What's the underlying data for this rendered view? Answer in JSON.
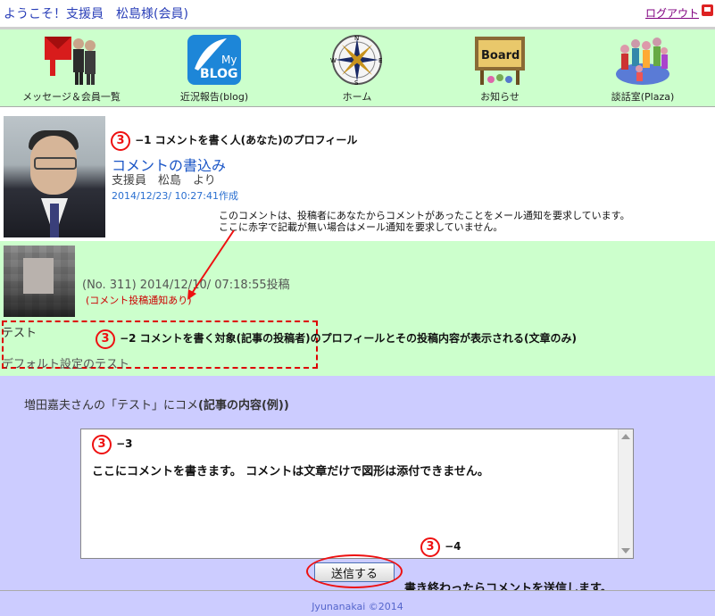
{
  "header": {
    "welcome": "ようこそ！支援員　松島様(会員)",
    "logout": "ログアウト"
  },
  "nav": [
    {
      "label": "メッセージ＆会員一覧",
      "icon": "message-members-icon"
    },
    {
      "label": "近況報告(blog)",
      "icon": "my-blog-icon",
      "badge_top": "My",
      "badge_bottom": "BLOG"
    },
    {
      "label": "ホーム",
      "icon": "compass-icon",
      "compass": [
        "N",
        "E",
        "S",
        "W"
      ]
    },
    {
      "label": "お知らせ",
      "icon": "board-icon",
      "board_text": "Board"
    },
    {
      "label": "談話室(Plaza)",
      "icon": "plaza-icon"
    }
  ],
  "profile": {
    "annotation_num": "3",
    "annotation_text": "−1 コメントを書く人(あなた)のプロフィール",
    "title": "コメントの書込み",
    "author": "支援員　松島　より",
    "created": "2014/12/23/ 10:27:41作成",
    "explain_1": "このコメントは、投稿者にあなたからコメントがあったことをメール通知を要求しています。",
    "explain_2": "ここに赤字で記載が無い場合はメール通知を要求していません。"
  },
  "article": {
    "post_info": "(No. 311) 2014/12/10/ 07:18:55投稿",
    "notify": "(コメント投稿通知あり)",
    "title": "テスト",
    "body": "デフォルト設定のテスト",
    "annotation_num": "3",
    "annotation_text": "−2 コメントを書く対象(記事の投稿者)のプロフィールとその投稿内容が表示される(文章のみ)"
  },
  "form": {
    "subject_prefix": "増田嘉夫さんの「テスト」にコメ",
    "subject_note": "(記事の内容(例))",
    "ta_annotation_num": "3",
    "ta_annotation_text": "−3",
    "ta_text": "ここにコメントを書きます。 コメントは文章だけで図形は添付できません。",
    "send_annotation_num": "3",
    "send_annotation_text": "−4",
    "send_label": "送信する",
    "send_note": "書き終わったらコメントを送信します。"
  },
  "footer": {
    "text": "Jyunanakai ©2014"
  },
  "colors": {
    "nav_bg": "#ccffcc",
    "form_bg": "#ccccff",
    "accent_red": "#e11111",
    "link_blue": "#1a55c6"
  }
}
